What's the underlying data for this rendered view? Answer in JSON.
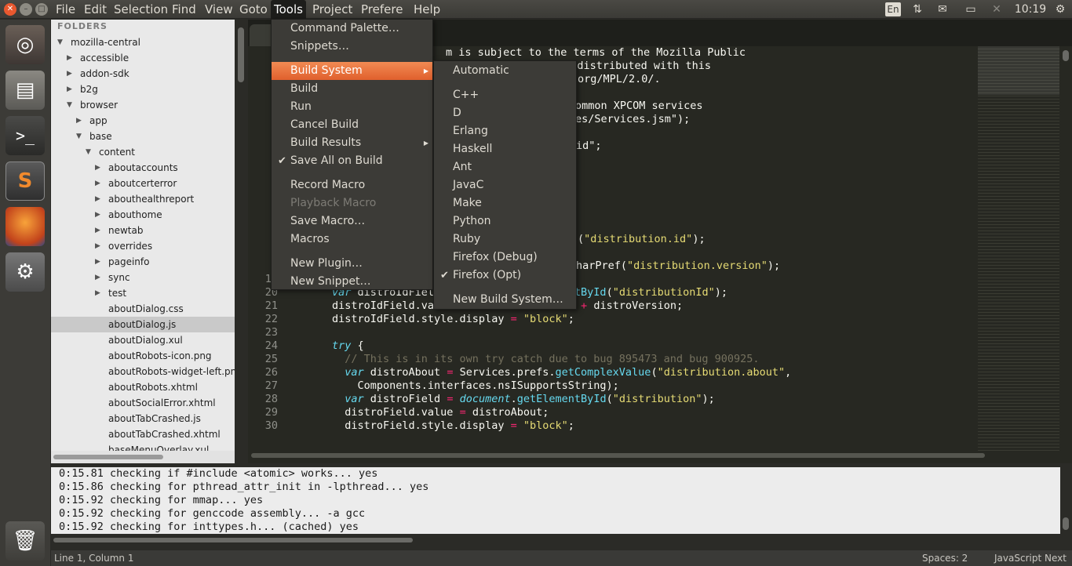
{
  "top_menu": {
    "items": [
      "File",
      "Edit",
      "Selection",
      "Find",
      "View",
      "Goto",
      "Tools",
      "Project",
      "Preferences",
      "Help"
    ],
    "tray": {
      "lang": "En",
      "clock": "10:19"
    }
  },
  "window_buttons": {
    "close": "✕",
    "min": "–",
    "max": "□"
  },
  "sidebar": {
    "title": "FOLDERS",
    "items": [
      {
        "label": "mozilla-central",
        "arrow": "▼"
      },
      {
        "label": "accessible",
        "arrow": "▶"
      },
      {
        "label": "addon-sdk",
        "arrow": "▶"
      },
      {
        "label": "b2g",
        "arrow": "▶"
      },
      {
        "label": "browser",
        "arrow": "▼"
      },
      {
        "label": "app",
        "arrow": "▶"
      },
      {
        "label": "base",
        "arrow": "▼"
      },
      {
        "label": "content",
        "arrow": "▼"
      },
      {
        "label": "aboutaccounts",
        "arrow": "▶"
      },
      {
        "label": "aboutcerterror",
        "arrow": "▶"
      },
      {
        "label": "abouthealthreport",
        "arrow": "▶"
      },
      {
        "label": "abouthome",
        "arrow": "▶"
      },
      {
        "label": "newtab",
        "arrow": "▶"
      },
      {
        "label": "overrides",
        "arrow": "▶"
      },
      {
        "label": "pageinfo",
        "arrow": "▶"
      },
      {
        "label": "sync",
        "arrow": "▶"
      },
      {
        "label": "test",
        "arrow": "▶"
      },
      {
        "label": "aboutDialog.css",
        "arrow": ""
      },
      {
        "label": "aboutDialog.js",
        "arrow": ""
      },
      {
        "label": "aboutDialog.xul",
        "arrow": ""
      },
      {
        "label": "aboutRobots-icon.png",
        "arrow": ""
      },
      {
        "label": "aboutRobots-widget-left.png",
        "arrow": ""
      },
      {
        "label": "aboutRobots.xhtml",
        "arrow": ""
      },
      {
        "label": "aboutSocialError.xhtml",
        "arrow": ""
      },
      {
        "label": "aboutTabCrashed.js",
        "arrow": ""
      },
      {
        "label": "aboutTabCrashed.xhtml",
        "arrow": ""
      },
      {
        "label": "baseMenuOverlay.xul",
        "arrow": ""
      }
    ]
  },
  "code": {
    "lines": [
      {
        "n": "",
        "t": "m is subject to the terms of the Mozilla Public"
      },
      {
        "n": "",
        "t": "ot distributed with this"
      },
      {
        "n": "",
        "t": "org/MPL/2.0/."
      },
      {
        "n": "",
        "t": ""
      },
      {
        "n": "",
        "t": "ommon XPCOM services"
      },
      {
        "n": "",
        "t": "es/Services.jsm\");"
      },
      {
        "n": "",
        "t": ""
      },
      {
        "n": "",
        "t": "id\";"
      },
      {
        "n": "1",
        "t": ""
      },
      {
        "n": "1",
        "t": ""
      },
      {
        "n": "1",
        "t": ""
      },
      {
        "n": "1",
        "t": ""
      },
      {
        "n": "1",
        "t": ""
      },
      {
        "n": "1",
        "t": ""
      },
      {
        "n": "1",
        "t": "(\"distribution.id\");"
      },
      {
        "n": "1",
        "t": ""
      },
      {
        "n": "1",
        "t": "harPref(\"distribution.version\");"
      },
      {
        "n": "19",
        "t": ""
      },
      {
        "n": "20",
        "t": "var distroIdField = document.getElementById(\"distributionId\");"
      },
      {
        "n": "21",
        "t": "distroIdField.value = distroId + \" - \" + distroVersion;"
      },
      {
        "n": "22",
        "t": "distroIdField.style.display = \"block\";"
      },
      {
        "n": "23",
        "t": ""
      },
      {
        "n": "24",
        "t": "try {"
      },
      {
        "n": "25",
        "t": "  // This is in its own try catch due to bug 895473 and bug 900925."
      },
      {
        "n": "26",
        "t": "  var distroAbout = Services.prefs.getComplexValue(\"distribution.about\","
      },
      {
        "n": "27",
        "t": "    Components.interfaces.nsISupportsString);"
      },
      {
        "n": "28",
        "t": "  var distroField = document.getElementById(\"distribution\");"
      },
      {
        "n": "29",
        "t": "  distroField.value = distroAbout;"
      },
      {
        "n": "30",
        "t": "  distroField.style.display = \"block\";"
      }
    ]
  },
  "tools_menu": {
    "items": [
      {
        "label": "Command Palette…",
        "state": "normal"
      },
      {
        "label": "Snippets…",
        "state": "normal"
      },
      {
        "label": "Build System",
        "state": "highlight",
        "submenu": true
      },
      {
        "label": "Build",
        "state": "normal"
      },
      {
        "label": "Run",
        "state": "normal"
      },
      {
        "label": "Cancel Build",
        "state": "normal"
      },
      {
        "label": "Build Results",
        "state": "normal",
        "submenu": true
      },
      {
        "label": "Save All on Build",
        "state": "checked"
      },
      {
        "label": "Record Macro",
        "state": "normal"
      },
      {
        "label": "Playback Macro",
        "state": "disabled"
      },
      {
        "label": "Save Macro…",
        "state": "normal"
      },
      {
        "label": "Macros",
        "state": "normal"
      },
      {
        "label": "New Plugin…",
        "state": "normal"
      },
      {
        "label": "New Snippet…",
        "state": "normal"
      }
    ]
  },
  "build_menu": {
    "items": [
      {
        "label": "Automatic",
        "checked": false
      },
      {
        "label": "C++",
        "checked": false
      },
      {
        "label": "D",
        "checked": false
      },
      {
        "label": "Erlang",
        "checked": false
      },
      {
        "label": "Haskell",
        "checked": false
      },
      {
        "label": "Ant",
        "checked": false
      },
      {
        "label": "JavaC",
        "checked": false
      },
      {
        "label": "Make",
        "checked": false
      },
      {
        "label": "Python",
        "checked": false
      },
      {
        "label": "Ruby",
        "checked": false
      },
      {
        "label": "Firefox (Debug)",
        "checked": false
      },
      {
        "label": "Firefox (Opt)",
        "checked": true
      },
      {
        "label": "New Build System…",
        "checked": false
      }
    ]
  },
  "output": {
    "lines": [
      "0:15.81 checking if #include <atomic> works... yes",
      "0:15.86 checking for pthread_attr_init in -lpthread... yes",
      "0:15.92 checking for mmap... yes",
      "0:15.92 checking for genccode assembly... -a gcc",
      "0:15.92 checking for inttypes.h... (cached) yes"
    ]
  },
  "status": {
    "position": "Line 1, Column 1",
    "spaces": "Spaces: 2",
    "syntax": "JavaScript Next"
  },
  "icons": {
    "check": "✔",
    "submenu": "▶",
    "checkmark_inline": "✓"
  },
  "colors": {
    "accent": "#e0602d",
    "editor_bg": "#272822",
    "panel_bg": "#3c3b37"
  }
}
